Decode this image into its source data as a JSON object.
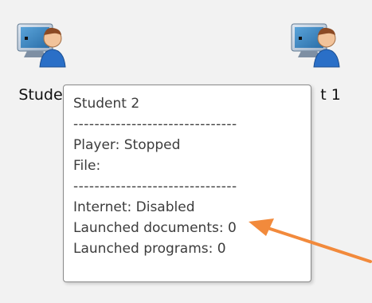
{
  "students": [
    {
      "label": "Stude"
    },
    {
      "label": "t 1"
    }
  ],
  "tooltip": {
    "title": "Student 2",
    "separator": "-------------------------------",
    "player": "Player:  Stopped",
    "file": "File:",
    "internet": "Internet:  Disabled",
    "documents": "Launched documents:  0",
    "programs": "Launched programs:  0"
  },
  "annotation": {
    "arrow_color": "#f28a3c"
  }
}
